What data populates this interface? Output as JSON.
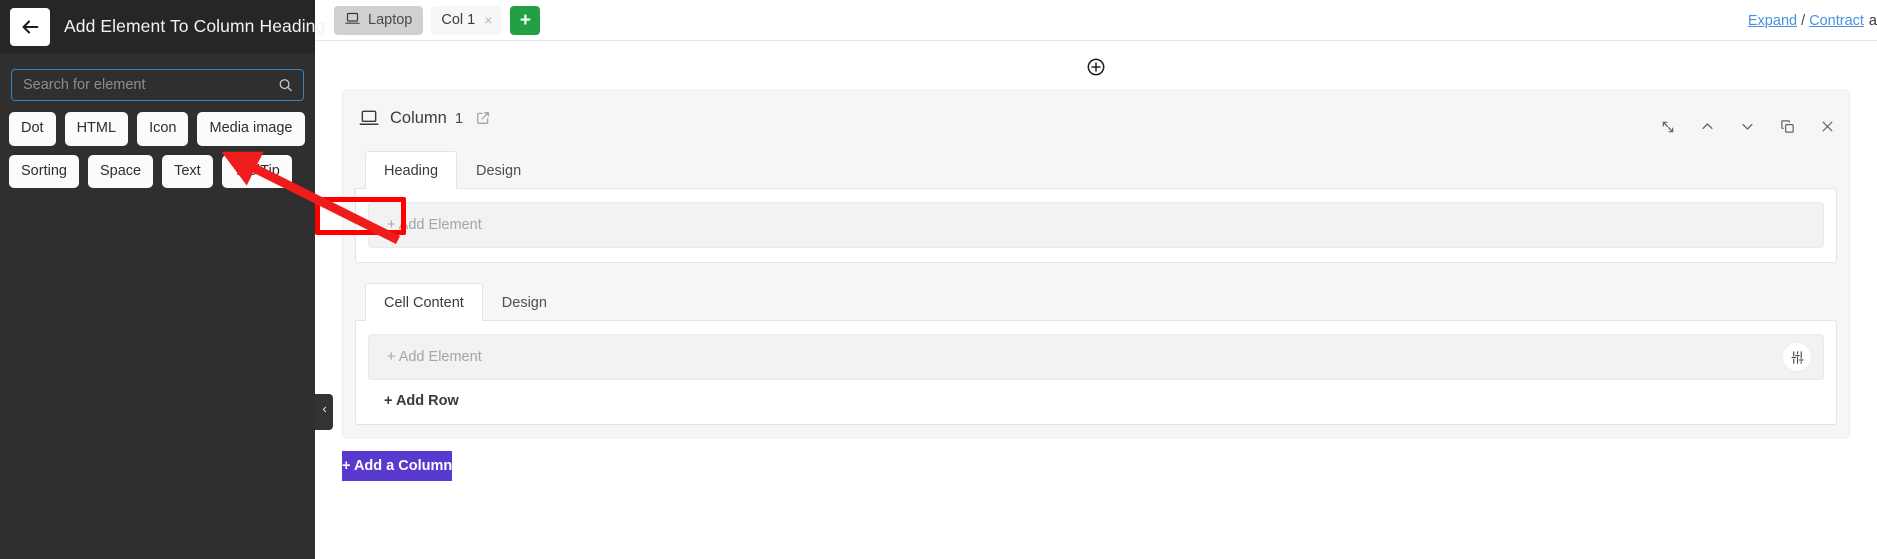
{
  "sidebar": {
    "back_icon": "arrow-left-icon",
    "title": "Add Element To Column Heading",
    "search": {
      "placeholder": "Search for element",
      "value": "",
      "icon": "search-icon"
    },
    "element_chips": [
      {
        "label": "Dot"
      },
      {
        "label": "HTML"
      },
      {
        "label": "Icon"
      },
      {
        "label": "Media image"
      },
      {
        "label": "Sorting"
      },
      {
        "label": "Space"
      },
      {
        "label": "Text"
      },
      {
        "label": "ToolTip"
      }
    ],
    "collapse_icon": "chevron-left-icon"
  },
  "topbar": {
    "device_tab": {
      "label": "Laptop",
      "icon": "laptop-icon"
    },
    "column_tab": {
      "label": "Col 1",
      "close_icon": "close-icon",
      "close_label": "×"
    },
    "add_tab_label": "+",
    "expand_label": "Expand",
    "separator": "/",
    "contract_label": "Contract",
    "trailing_text": "a"
  },
  "canvas": {
    "add_section_icon": "circle-plus-icon",
    "column": {
      "device_icon": "laptop-icon",
      "title": "Column",
      "number": "1",
      "edit_icon": "edit-square-icon",
      "actions": [
        {
          "name": "collapse-icon",
          "title": "Collapse"
        },
        {
          "name": "chevron-up-icon",
          "title": "Move up"
        },
        {
          "name": "chevron-down-icon",
          "title": "Move down"
        },
        {
          "name": "duplicate-icon",
          "title": "Duplicate"
        },
        {
          "name": "close-icon",
          "title": "Remove"
        }
      ],
      "heading_panel": {
        "tabs": [
          {
            "label": "Heading",
            "active": true
          },
          {
            "label": "Design",
            "active": false
          }
        ],
        "add_element_label": "+ Add Element"
      },
      "cell_panel": {
        "tabs": [
          {
            "label": "Cell Content",
            "active": true
          },
          {
            "label": "Design",
            "active": false
          }
        ],
        "add_element_label": "+ Add Element",
        "settings_icon": "sliders-icon",
        "add_row_label": "+ Add Row"
      }
    },
    "add_column_label": "+ Add a Column"
  },
  "annotation": {
    "highlight_color": "#ff0000",
    "arrow_color": "#ef1c1c",
    "target": "+ Add Element"
  },
  "colors": {
    "sidebar_bg": "#2f2f2f",
    "sidebar_header_bg": "#262626",
    "accent_green": "#22a042",
    "accent_purple": "#5a39ce",
    "link_blue": "#4a90e2",
    "annotation_red": "#ff0000"
  }
}
